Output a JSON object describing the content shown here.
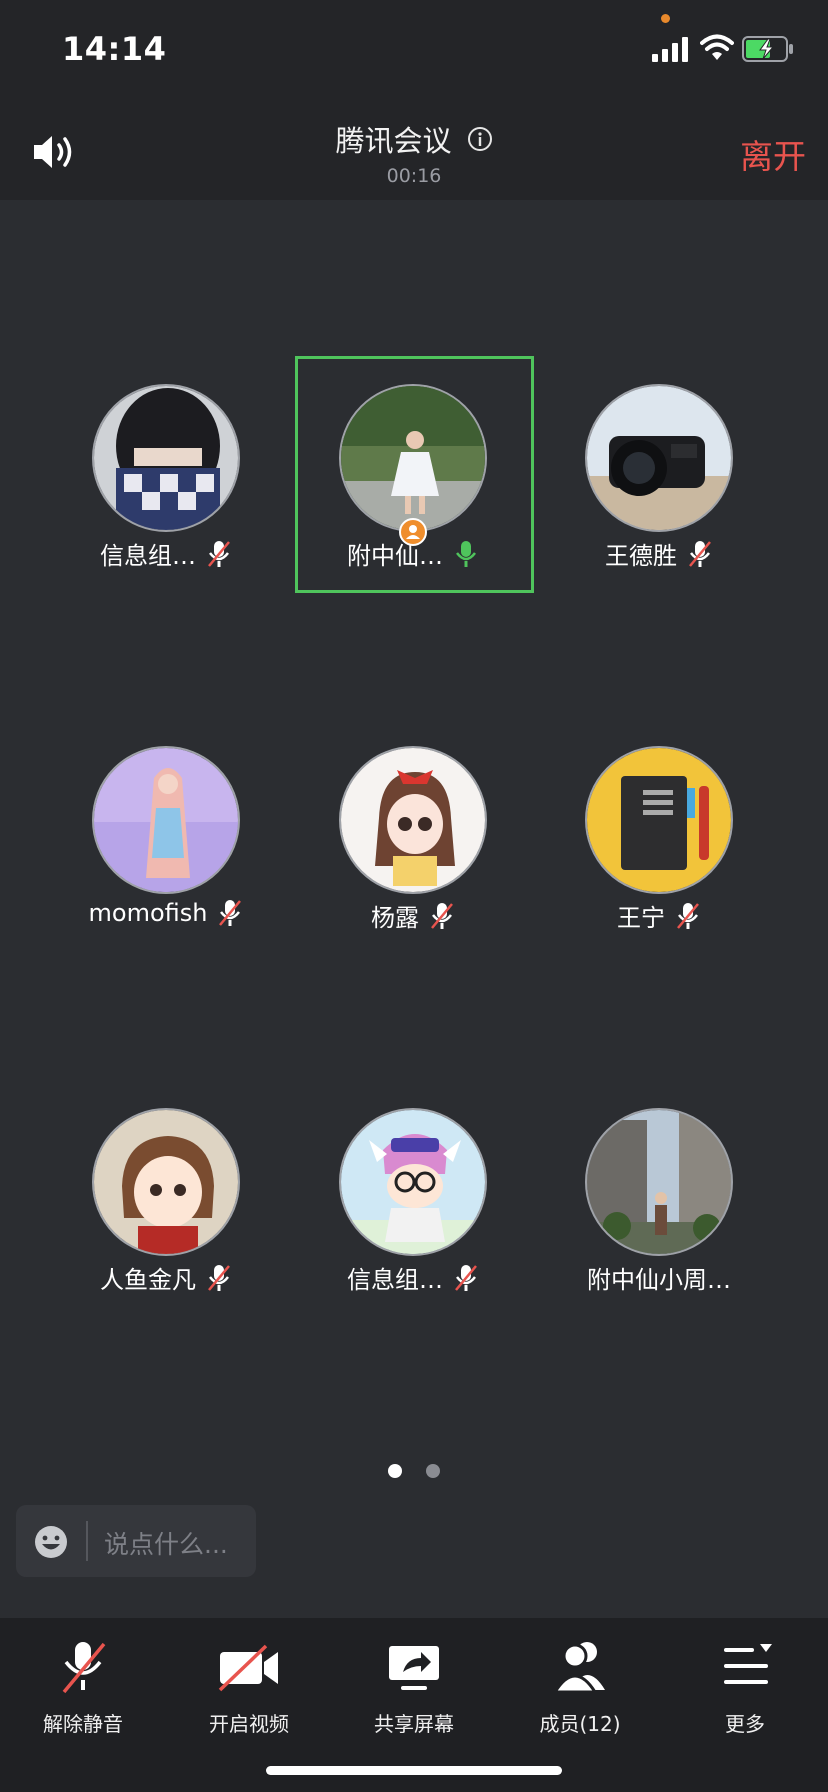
{
  "status_bar": {
    "time": "14:14",
    "icons": [
      "signal-icon",
      "wifi-icon",
      "battery-charging-icon"
    ]
  },
  "header": {
    "title": "腾讯会议",
    "timer": "00:16",
    "leave_label": "离开",
    "leave_color": "#e8544e"
  },
  "participants": [
    {
      "name": "信息组…",
      "mic": "muted"
    },
    {
      "name": "附中仙…",
      "mic": "speaking",
      "host": true
    },
    {
      "name": "王德胜",
      "mic": "muted"
    },
    {
      "name": "momofish",
      "mic": "muted"
    },
    {
      "name": "杨露",
      "mic": "muted"
    },
    {
      "name": "王宁",
      "mic": "muted"
    },
    {
      "name": "人鱼金凡",
      "mic": "muted"
    },
    {
      "name": "信息组…",
      "mic": "muted"
    },
    {
      "name": "附中仙小周…",
      "mic": "none"
    }
  ],
  "pagination": {
    "current": 1,
    "total": 2
  },
  "chat": {
    "placeholder": "说点什么..."
  },
  "toolbar": {
    "unmute_label": "解除静音",
    "video_label": "开启视频",
    "share_label": "共享屏幕",
    "members_label": "成员(12)",
    "more_label": "更多"
  },
  "colors": {
    "accent_green": "#4fc45c",
    "mute_red": "#e8544e",
    "host_badge": "#ef8e2d"
  }
}
